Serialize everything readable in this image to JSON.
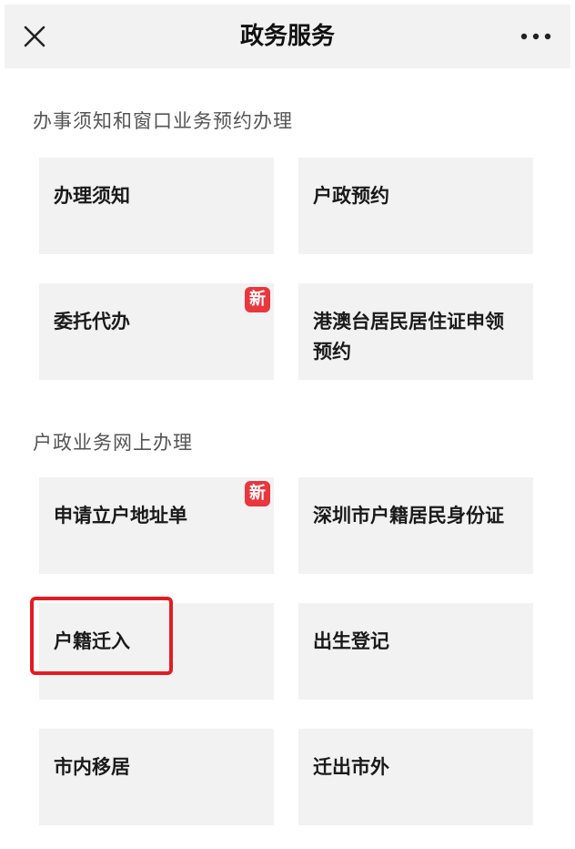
{
  "header": {
    "title": "政务服务",
    "close_icon": "close-icon",
    "more_icon": "more-icon"
  },
  "sections": [
    {
      "title": "办事须知和窗口业务预约办理",
      "items": [
        {
          "label": "办理须知"
        },
        {
          "label": "户政预约"
        },
        {
          "label": "委托代办",
          "badge": "新"
        },
        {
          "label": "港澳台居民居住证申领预约"
        }
      ]
    },
    {
      "title": "户政业务网上办理",
      "items": [
        {
          "label": "申请立户地址单",
          "badge": "新"
        },
        {
          "label": "深圳市户籍居民身份证"
        },
        {
          "label": "户籍迁入"
        },
        {
          "label": "出生登记"
        },
        {
          "label": "市内移居"
        },
        {
          "label": "迁出市外"
        }
      ]
    }
  ],
  "colors": {
    "card_background": "#f2f2f2",
    "badge": "#e8383d",
    "highlight": "#e21c22"
  }
}
